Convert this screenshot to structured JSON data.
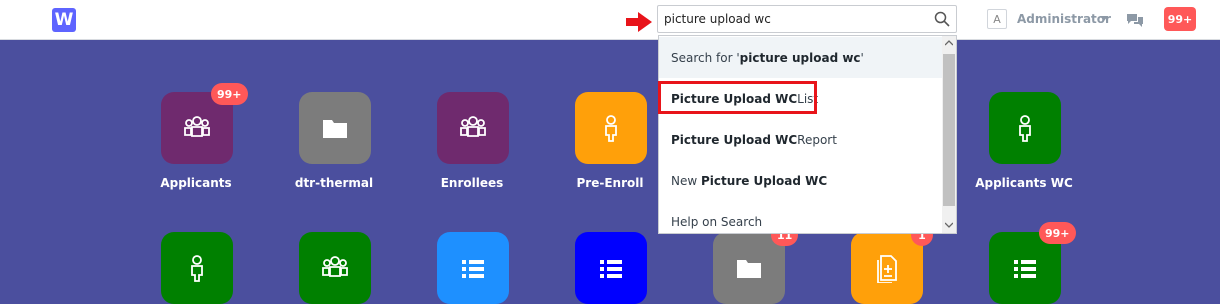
{
  "header": {
    "logo_letter": "W",
    "search": {
      "value": "picture upload wc",
      "placeholder": ""
    },
    "user_initial": "A",
    "user_name": "Administrator",
    "notifications": "99+"
  },
  "search_results": {
    "first": {
      "prefix": "Search for '",
      "term": "picture upload wc",
      "suffix": "'"
    },
    "items": [
      {
        "bold": "Picture Upload WC",
        "rest": " List"
      },
      {
        "bold": "Picture Upload WC",
        "rest": " Report"
      },
      {
        "lead": "New ",
        "bold": "Picture Upload WC"
      },
      {
        "text": "Help on Search"
      }
    ]
  },
  "modules": {
    "row1": [
      {
        "label": "Applicants",
        "badge": "99+",
        "color": "#6f2a6e",
        "icon": "users-icon"
      },
      {
        "label": "dtr-thermal",
        "color": "#7c7c7c",
        "icon": "folder-icon"
      },
      {
        "label": "Enrollees",
        "color": "#6f2a6e",
        "icon": "users-icon"
      },
      {
        "label": "Pre-Enroll",
        "color": "#ffa00a",
        "icon": "user-icon"
      },
      {
        "label": "Applicants WC",
        "color": "#008000",
        "icon": "user-icon"
      }
    ],
    "row2": [
      {
        "color": "#008000",
        "icon": "user-icon"
      },
      {
        "color": "#008000",
        "icon": "users-icon"
      },
      {
        "color": "#1e90ff",
        "icon": "list-icon"
      },
      {
        "color": "#0000ff",
        "icon": "list-icon"
      },
      {
        "color": "#7c7c7c",
        "icon": "folder-icon",
        "badge": "11"
      },
      {
        "color": "#ffa00a",
        "icon": "document-icon",
        "badge": "1"
      },
      {
        "color": "#008000",
        "icon": "list-icon",
        "badge": "99+"
      }
    ]
  },
  "colors": {
    "background": "#4b4f9e",
    "badge": "#ff5858",
    "highlight": "#e8141a"
  }
}
